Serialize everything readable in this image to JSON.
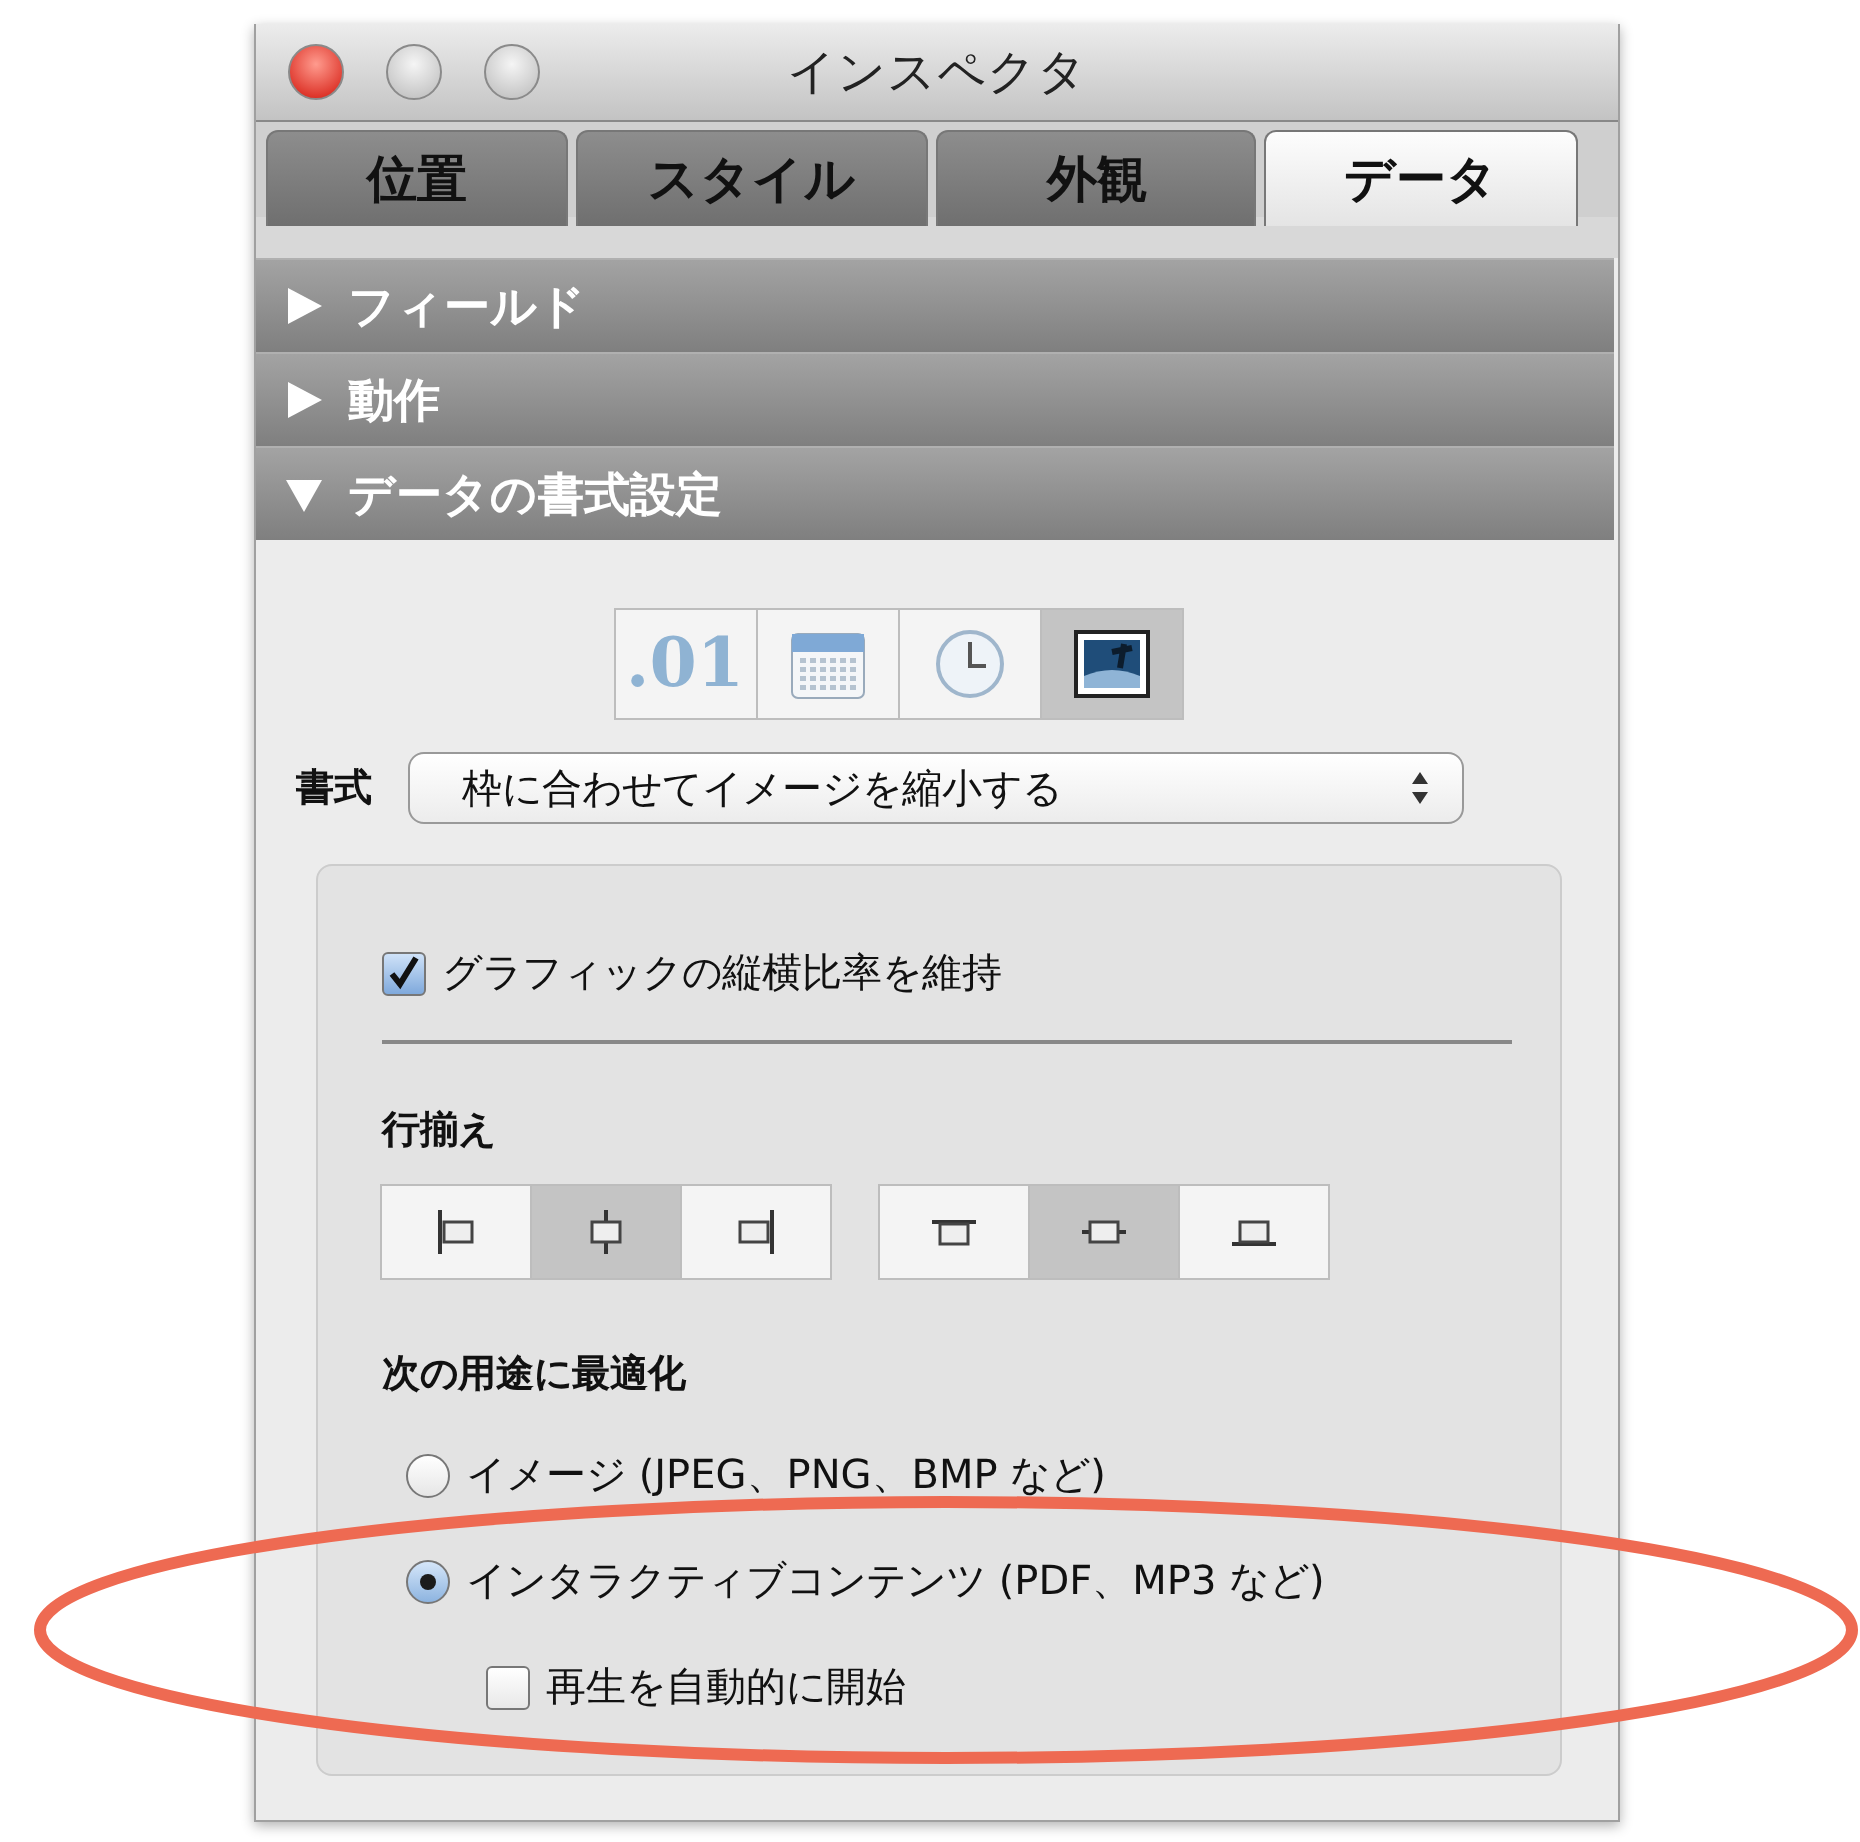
{
  "window": {
    "title": "インスペクタ"
  },
  "tabs": [
    {
      "label": "位置",
      "selected": false
    },
    {
      "label": "スタイル",
      "selected": false
    },
    {
      "label": "外観",
      "selected": false
    },
    {
      "label": "データ",
      "selected": true
    }
  ],
  "sections": [
    {
      "label": "フィールド",
      "expanded": false
    },
    {
      "label": "動作",
      "expanded": false
    },
    {
      "label": "データの書式設定",
      "expanded": true
    }
  ],
  "format_types": [
    {
      "kind": "number",
      "label": ".01",
      "selected": false
    },
    {
      "kind": "date",
      "selected": false
    },
    {
      "kind": "time",
      "selected": false
    },
    {
      "kind": "image",
      "selected": true
    }
  ],
  "format": {
    "label": "書式",
    "value": "枠に合わせてイメージを縮小する"
  },
  "keep_ratio": {
    "label": "グラフィックの縦横比率を維持",
    "checked": true
  },
  "alignment": {
    "label": "行揃え",
    "horizontal": [
      {
        "kind": "left",
        "selected": false
      },
      {
        "kind": "center",
        "selected": true
      },
      {
        "kind": "right",
        "selected": false
      }
    ],
    "vertical": [
      {
        "kind": "top",
        "selected": false
      },
      {
        "kind": "middle",
        "selected": true
      },
      {
        "kind": "bottom",
        "selected": false
      }
    ]
  },
  "optimize": {
    "label": "次の用途に最適化",
    "options": [
      {
        "label": "イメージ (JPEG、PNG、BMP など)",
        "selected": false
      },
      {
        "label": "インタラクティブコンテンツ (PDF、MP3 など)",
        "selected": true
      }
    ],
    "autoplay": {
      "label": "再生を自動的に開始",
      "checked": false
    }
  }
}
